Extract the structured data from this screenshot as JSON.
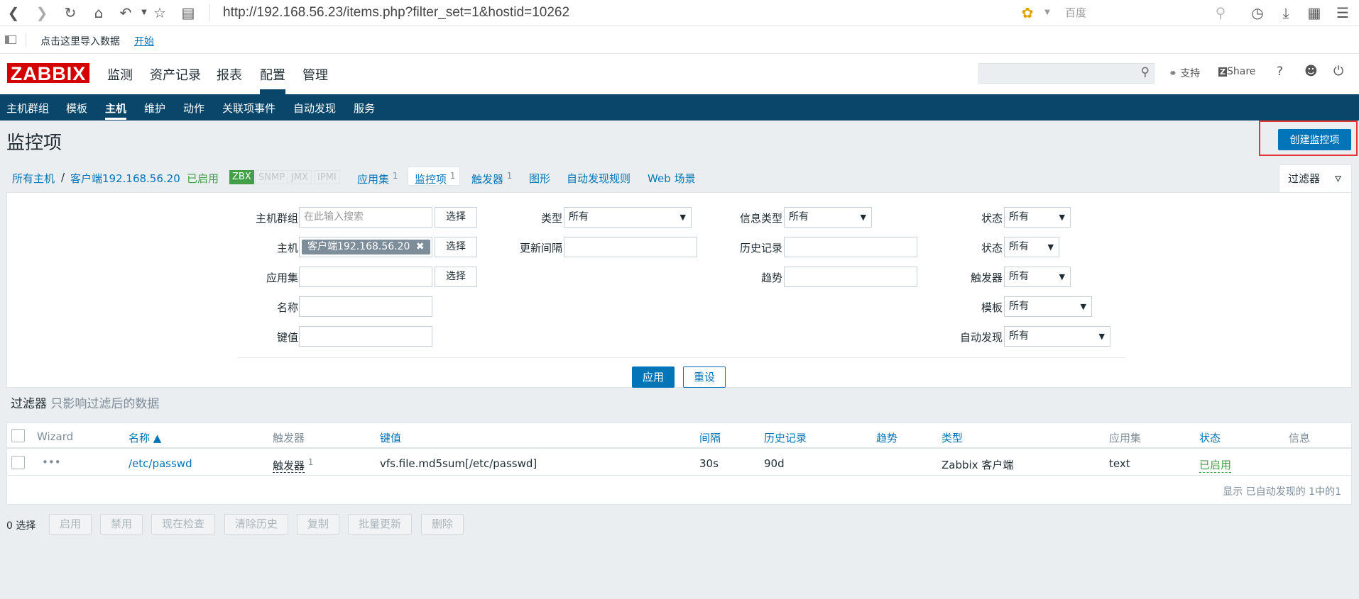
{
  "browser": {
    "url": "http://192.168.56.23/items.php?filter_set=1&hostid=10262",
    "search_placeholder": "百度",
    "bookmark_import": "点击这里导入数据",
    "bookmark_start": "开始"
  },
  "logo": "ZABBIX",
  "main_menu": [
    "监测",
    "资产记录",
    "报表",
    "配置",
    "管理"
  ],
  "header_links": {
    "support": "支持",
    "share": "Share",
    "help": "?"
  },
  "sub_menu": [
    "主机群组",
    "模板",
    "主机",
    "维护",
    "动作",
    "关联项事件",
    "自动发现",
    "服务"
  ],
  "page_title": "监控项",
  "create_button": "创建监控项",
  "breadcrumb": {
    "all_hosts": "所有主机",
    "separator": "/",
    "host": "客户端192.168.56.20",
    "enabled": "已启用",
    "tags": [
      "ZBX",
      "SNMP",
      "JMX",
      "IPMI"
    ],
    "apps": "应用集",
    "apps_count": "1",
    "items": "监控项",
    "items_count": "1",
    "triggers": "触发器",
    "triggers_count": "1",
    "graphs": "图形",
    "discovery": "自动发现规则",
    "web": "Web 场景"
  },
  "filter_tab": "过滤器",
  "filter": {
    "host_group_label": "主机群组",
    "host_group_placeholder": "在此输入搜索",
    "select": "选择",
    "host_label": "主机",
    "host_chip": "客户端192.168.56.20",
    "application_label": "应用集",
    "name_label": "名称",
    "key_label": "键值",
    "type_label": "类型",
    "type_value": "所有",
    "update_interval_label": "更新间隔",
    "info_type_label": "信息类型",
    "info_type_value": "所有",
    "history_label": "历史记录",
    "trends_label": "趋势",
    "state_label": "状态",
    "state_value": "所有",
    "status_label": "状态",
    "status_value": "所有",
    "triggers_label": "触发器",
    "triggers_value": "所有",
    "template_label": "模板",
    "template_value": "所有",
    "discovery_label": "自动发现",
    "discovery_value": "所有",
    "apply": "应用",
    "reset": "重设"
  },
  "filter_note_main": "过滤器",
  "filter_note_sub": "只影响过滤后的数据",
  "table": {
    "headers": [
      "Wizard",
      "名称 ▲",
      "触发器",
      "键值",
      "间隔",
      "历史记录",
      "趋势",
      "类型",
      "应用集",
      "状态",
      "信息"
    ],
    "rows": [
      {
        "wizard": "•••",
        "name": "/etc/passwd",
        "triggers": "触发器",
        "triggers_count": "1",
        "key": "vfs.file.md5sum[/etc/passwd]",
        "interval": "30s",
        "history": "90d",
        "trends": "",
        "type": "Zabbix 客户端",
        "application": "text",
        "status": "已启用",
        "info": ""
      }
    ],
    "footer": "显示 已自动发现的 1中的1"
  },
  "bulk": {
    "selected": "0 选择",
    "buttons": [
      "启用",
      "禁用",
      "现在检查",
      "清除历史",
      "复制",
      "批量更新",
      "删除"
    ]
  }
}
